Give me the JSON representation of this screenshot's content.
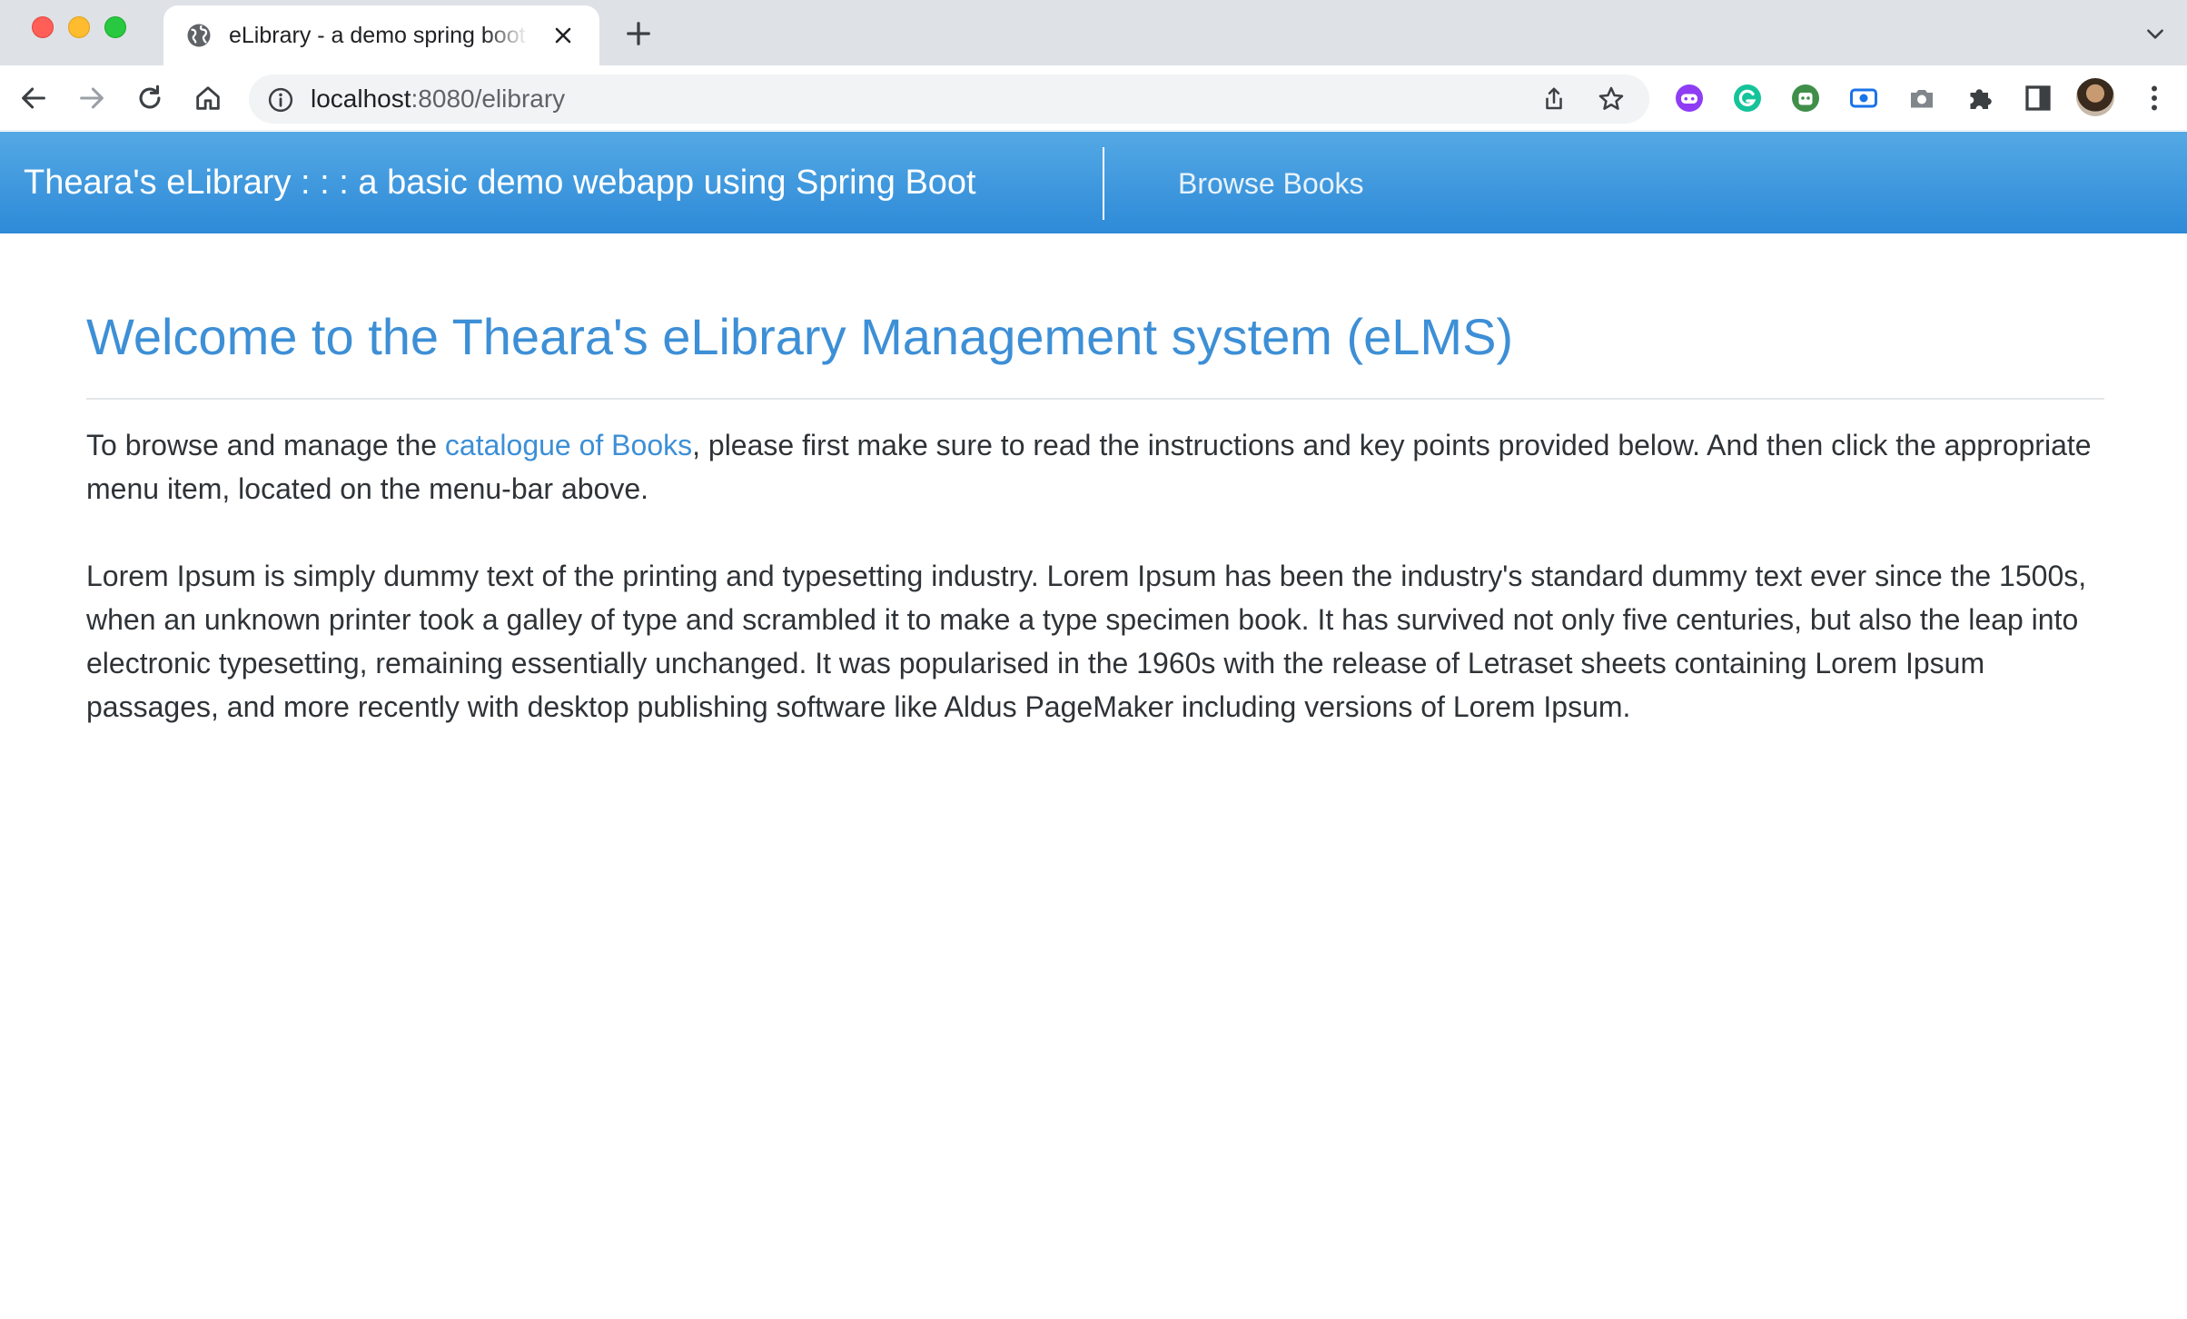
{
  "browser": {
    "tab": {
      "title": "eLibrary - a demo spring boot webapp"
    },
    "address_bar": {
      "host": "localhost",
      "path": ":8080/elibrary"
    },
    "extensions": [
      {
        "icon": "purple-extension-icon",
        "color": "#8e3df5"
      },
      {
        "icon": "grammarly-icon",
        "color": "#15c39a"
      },
      {
        "icon": "robot-extension-icon",
        "color": "#3f8f4a"
      },
      {
        "icon": "screen-record-icon",
        "color": "#1a73e8"
      },
      {
        "icon": "camera-icon",
        "color": "#80868b"
      },
      {
        "icon": "puzzle-icon",
        "color": "#3c4043"
      },
      {
        "icon": "side-panel-icon",
        "color": "#3c4043"
      }
    ]
  },
  "navbar": {
    "brand": "Theara's eLibrary : : : a basic demo webapp using Spring Boot",
    "links": [
      {
        "label": "Browse Books"
      }
    ],
    "gradient_top": "#54a9e4",
    "gradient_bottom": "#2e8ad8"
  },
  "main": {
    "title": "Welcome to the Theara's eLibrary Management system (eLMS)",
    "intro": {
      "before_link": "To browse and manage the ",
      "link": "catalogue of Books",
      "after_link": ", please first make sure to read the instructions and key points provided below. And then click the appropriate menu item, located on the menu-bar above."
    },
    "body_text": "Lorem Ipsum is simply dummy text of the printing and typesetting industry. Lorem Ipsum has been the industry's standard dummy text ever since the 1500s, when an unknown printer took a galley of type and scrambled it to make a type specimen book. It has survived not only five centuries, but also the leap into electronic typesetting, remaining essentially unchanged. It was popularised in the 1960s with the release of Letraset sheets containing Lorem Ipsum passages, and more recently with desktop publishing software like Aldus PageMaker including versions of Lorem Ipsum."
  },
  "colors": {
    "accent": "#3d8fd6",
    "text": "#2f3337"
  }
}
